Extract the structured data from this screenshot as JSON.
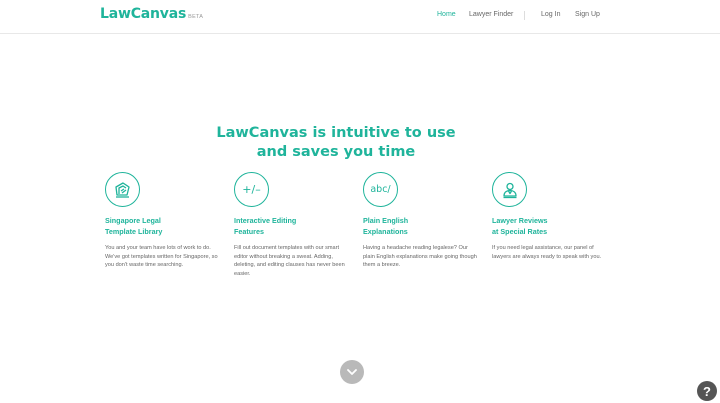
{
  "brand": {
    "name": "LawCanvas",
    "badge": "BETA"
  },
  "nav": {
    "home": "Home",
    "lawyer_finder": "Lawyer Finder",
    "log_in": "Log In",
    "sign_up": "Sign Up"
  },
  "headline": {
    "line1": "LawCanvas is intuitive to use",
    "line2": "and saves you time"
  },
  "features": [
    {
      "icon": "document-template-icon",
      "title_line1": "Singapore Legal",
      "title_line2": "Template Library",
      "description": "You and your team have lots of work to do. We've got templates written for Singapore, so you don't waste time searching."
    },
    {
      "icon": "plus-minus-icon",
      "icon_text": "+/–",
      "title_line1": "Interactive Editing",
      "title_line2": "Features",
      "description": "Fill out document templates with our smart editor without breaking a sweat. Adding, deleting, and editing clauses has never been easier."
    },
    {
      "icon": "abc-text-icon",
      "icon_text": "abc/",
      "title_line1": "Plain English",
      "title_line2": "Explanations",
      "description": "Having a headache reading legalese? Our plain English explanations make going though them a breeze."
    },
    {
      "icon": "lawyer-person-icon",
      "title_line1": "Lawyer Reviews",
      "title_line2": "at Special Rates",
      "description": "If you need legal assistance, our panel of lawyers are always ready to speak with you."
    }
  ],
  "help": {
    "glyph": "?"
  },
  "colors": {
    "accent": "#1fb49b",
    "scroll_button": "#b9b9b9",
    "help_button": "#555555"
  }
}
